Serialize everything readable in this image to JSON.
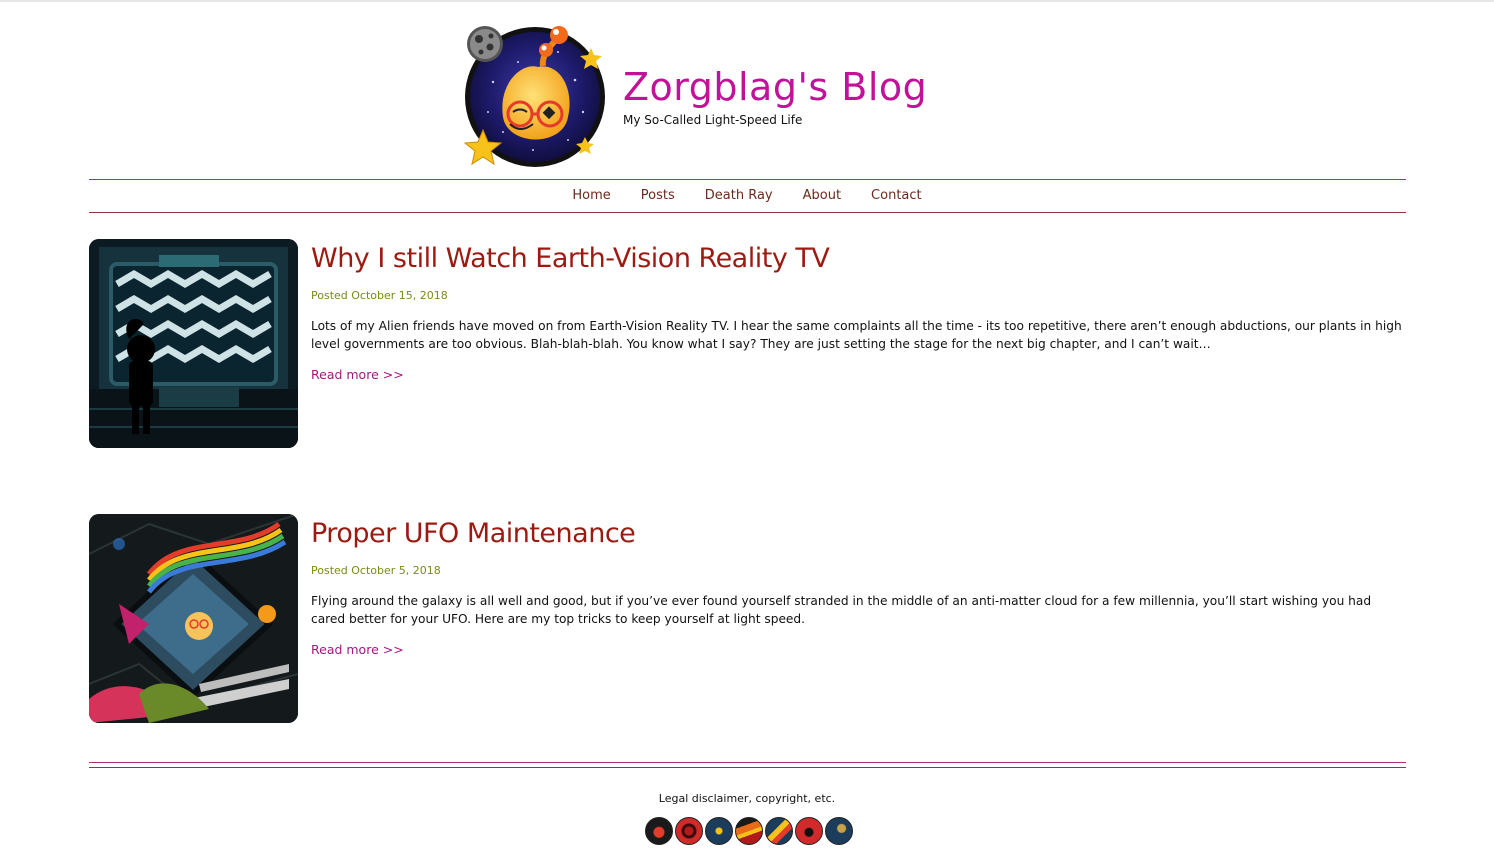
{
  "site": {
    "title": "Zorgblag's Blog",
    "tagline": "My So-Called Light-Speed Life"
  },
  "nav": {
    "items": [
      {
        "label": "Home"
      },
      {
        "label": "Posts"
      },
      {
        "label": "Death Ray"
      },
      {
        "label": "About"
      },
      {
        "label": "Contact"
      }
    ]
  },
  "posts": [
    {
      "title": "Why I still Watch Earth-Vision Reality TV",
      "date": "Posted October 15, 2018",
      "excerpt": "Lots of my Alien friends have moved on from Earth-Vision Reality TV. I hear the same complaints all the time - its too repetitive, there aren’t enough abductions, our plants in high level governments are too obvious. Blah-blah-blah. You know what I say? They are just setting the stage for the next big chapter, and I can’t wait…",
      "read_more": "Read more >>"
    },
    {
      "title": "Proper UFO Maintenance",
      "date": "Posted October 5, 2018",
      "excerpt": "Flying around the galaxy is all well and good, but if you’ve ever found yourself stranded in the middle of an anti-matter cloud for a few millennia, you’ll start wishing you had cared better for your UFO. Here are my top tricks to keep yourself at light speed.",
      "read_more": "Read more >>"
    }
  ],
  "footer": {
    "legal": "Legal disclaimer, copyright, etc.",
    "social_icons": [
      "ufo-icon",
      "red-swirl-icon",
      "blue-diamond-icon",
      "flame-icon",
      "comet-icon",
      "red-eye-icon",
      "meteor-icon"
    ]
  }
}
